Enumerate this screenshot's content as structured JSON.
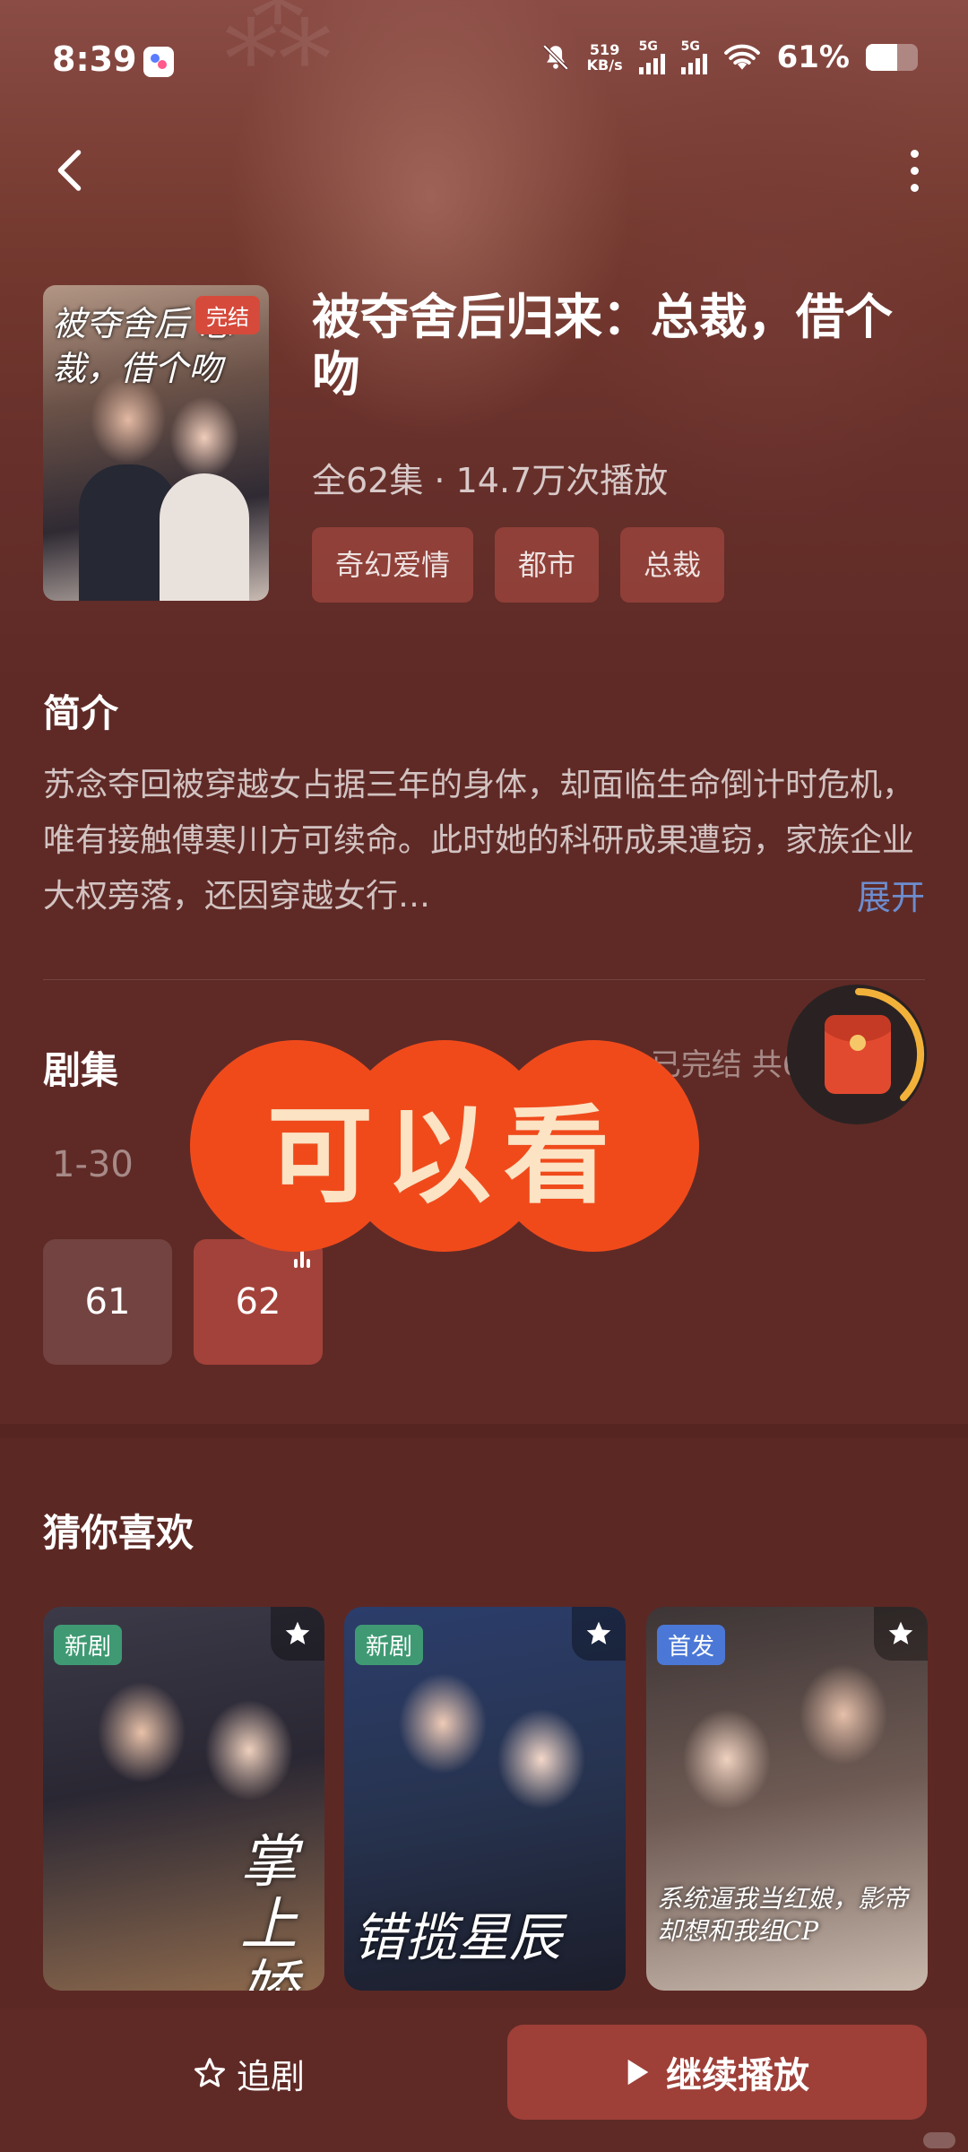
{
  "status_bar": {
    "time": "8:39",
    "net_speed_value": "519",
    "net_speed_unit": "KB/s",
    "sim1": "5G",
    "sim2": "5G",
    "battery": "61%",
    "battery_level": 0.61
  },
  "drama": {
    "poster_title": "被夺舍后 总裁，借个吻",
    "status_badge": "完结",
    "title": "被夺舍后归来：总裁，借个吻",
    "meta": "全62集 · 14.7万次播放",
    "tags": [
      "奇幻爱情",
      "都市",
      "总裁"
    ]
  },
  "intro": {
    "heading": "简介",
    "text": "苏念夺回被穿越女占据三年的身体，却面临生命倒计时危机，唯有接触傅寒川方可续命。此时她的科研成果遭窃，家族企业大权旁落，还因穿越女行…",
    "expand": "展开"
  },
  "episodes": {
    "heading": "剧集",
    "status": "已完结 共62集",
    "range": "1-30",
    "items": [
      "61",
      "62"
    ],
    "playing": "62"
  },
  "overlay": {
    "sticker_text": "可以看"
  },
  "recommend": {
    "heading": "猜你喜欢",
    "cards": [
      {
        "label": "新剧",
        "title": "掌上娇"
      },
      {
        "label": "新剧",
        "title": "错揽星辰"
      },
      {
        "label": "首发",
        "title": "系统逼我当红娘，影帝却想和我组CP"
      }
    ]
  },
  "bottom": {
    "follow": "追剧",
    "play": "继续播放"
  },
  "icons": {
    "back": "chevron-left-icon",
    "more": "more-vertical-icon",
    "mute": "bell-off-icon",
    "wifi": "wifi-icon",
    "star": "star-icon",
    "play": "play-icon",
    "red_packet": "red-packet-icon"
  },
  "colors": {
    "background": "#5f2a26",
    "primary_button": "#9e3f38",
    "expand_link": "#6d8dcf",
    "sticker": "#f04a1b",
    "sticker_text": "#fbe3c4"
  }
}
